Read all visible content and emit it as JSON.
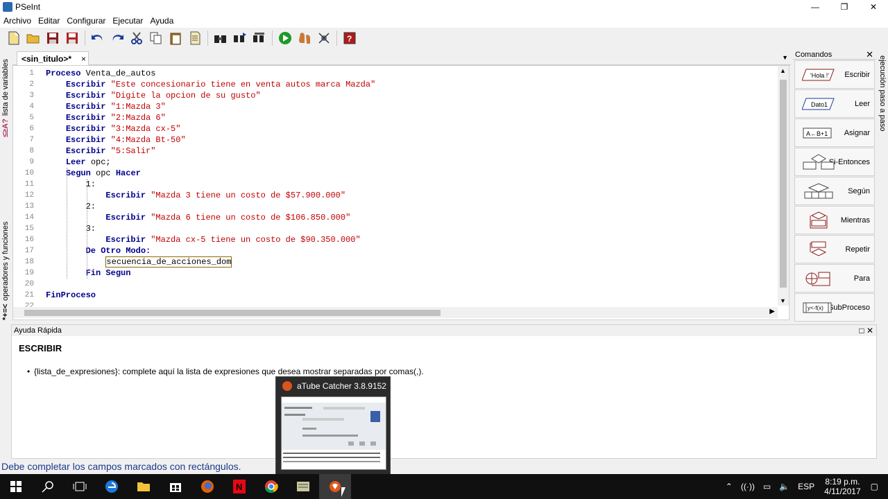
{
  "window": {
    "title": "PSeInt",
    "controls": [
      "—",
      "❐",
      "✕"
    ]
  },
  "menu": [
    "Archivo",
    "Editar",
    "Configurar",
    "Ejecutar",
    "Ayuda"
  ],
  "toolbar": {
    "icons": [
      "new-file-icon",
      "open-folder-icon",
      "save-icon",
      "save-as-icon",
      "undo-icon",
      "redo-icon",
      "cut-icon",
      "copy-icon",
      "paste-icon",
      "edit-icon",
      "search-icon",
      "find-next-icon",
      "replace-icon",
      "run-icon",
      "step-icon",
      "debug-icon",
      "help-icon"
    ]
  },
  "left_strip": {
    "variables_label": "lista de variables",
    "operators_label": "operadores y funciones",
    "var_glyphs": "≤≥A?",
    "op_glyphs": "*+=<"
  },
  "right_strip": {
    "label": "ejecución paso a paso"
  },
  "tab": {
    "label": "<sin_titulo>*",
    "close": "×"
  },
  "editor": {
    "line_numbers": [
      "1",
      "2",
      "3",
      "4",
      "5",
      "6",
      "7",
      "8",
      "9",
      "10",
      "11",
      "12",
      "13",
      "14",
      "15",
      "16",
      "17",
      "18",
      "19",
      "20",
      "21",
      "22"
    ],
    "lines": [
      [
        {
          "t": "kw",
          "v": "Proceso"
        },
        {
          "t": "n",
          "v": " Venta_de_autos"
        }
      ],
      [
        {
          "t": "n",
          "v": "    "
        },
        {
          "t": "kw",
          "v": "Escribir"
        },
        {
          "t": "n",
          "v": " "
        },
        {
          "t": "str",
          "v": "\"Este concesionario tiene en venta autos marca Mazda\""
        }
      ],
      [
        {
          "t": "n",
          "v": "    "
        },
        {
          "t": "kw",
          "v": "Escribir"
        },
        {
          "t": "n",
          "v": " "
        },
        {
          "t": "str",
          "v": "\"Digite la opcion de su gusto\""
        }
      ],
      [
        {
          "t": "n",
          "v": "    "
        },
        {
          "t": "kw",
          "v": "Escribir"
        },
        {
          "t": "n",
          "v": " "
        },
        {
          "t": "str",
          "v": "\"1:Mazda 3\""
        }
      ],
      [
        {
          "t": "n",
          "v": "    "
        },
        {
          "t": "kw",
          "v": "Escribir"
        },
        {
          "t": "n",
          "v": " "
        },
        {
          "t": "str",
          "v": "\"2:Mazda 6\""
        }
      ],
      [
        {
          "t": "n",
          "v": "    "
        },
        {
          "t": "kw",
          "v": "Escribir"
        },
        {
          "t": "n",
          "v": " "
        },
        {
          "t": "str",
          "v": "\"3:Mazda cx-5\""
        }
      ],
      [
        {
          "t": "n",
          "v": "    "
        },
        {
          "t": "kw",
          "v": "Escribir"
        },
        {
          "t": "n",
          "v": " "
        },
        {
          "t": "str",
          "v": "\"4:Mazda Bt-50\""
        }
      ],
      [
        {
          "t": "n",
          "v": "    "
        },
        {
          "t": "kw",
          "v": "Escribir"
        },
        {
          "t": "n",
          "v": " "
        },
        {
          "t": "str",
          "v": "\"5:Salir\""
        }
      ],
      [
        {
          "t": "n",
          "v": "    "
        },
        {
          "t": "kw",
          "v": "Leer"
        },
        {
          "t": "n",
          "v": " opc;"
        }
      ],
      [
        {
          "t": "n",
          "v": "    "
        },
        {
          "t": "kw",
          "v": "Segun"
        },
        {
          "t": "n",
          "v": " opc "
        },
        {
          "t": "kw",
          "v": "Hacer"
        }
      ],
      [
        {
          "t": "n",
          "v": "        1:"
        }
      ],
      [
        {
          "t": "n",
          "v": "            "
        },
        {
          "t": "kw",
          "v": "Escribir"
        },
        {
          "t": "n",
          "v": " "
        },
        {
          "t": "str",
          "v": "\"Mazda 3 tiene un costo de $57.900.000\""
        }
      ],
      [
        {
          "t": "n",
          "v": "        2:"
        }
      ],
      [
        {
          "t": "n",
          "v": "            "
        },
        {
          "t": "kw",
          "v": "Escribir"
        },
        {
          "t": "n",
          "v": " "
        },
        {
          "t": "str",
          "v": "\"Mazda 6 tiene un costo de $106.850.000\""
        }
      ],
      [
        {
          "t": "n",
          "v": "        3:"
        }
      ],
      [
        {
          "t": "n",
          "v": "            "
        },
        {
          "t": "kw",
          "v": "Escribir"
        },
        {
          "t": "n",
          "v": " "
        },
        {
          "t": "str",
          "v": "\"Mazda cx-5 tiene un costo de $90.350.000\""
        }
      ],
      [
        {
          "t": "n",
          "v": "        "
        },
        {
          "t": "kw",
          "v": "De Otro Modo:"
        }
      ],
      [
        {
          "t": "n",
          "v": "            "
        },
        {
          "t": "box",
          "v": "secuencia_de_acciones_dom"
        }
      ],
      [
        {
          "t": "n",
          "v": "        "
        },
        {
          "t": "kw",
          "v": "Fin Segun"
        }
      ],
      [
        {
          "t": "n",
          "v": ""
        }
      ],
      [
        {
          "t": "kw",
          "v": "FinProceso"
        }
      ],
      [
        {
          "t": "n",
          "v": ""
        }
      ]
    ]
  },
  "commands": {
    "title": "Comandos",
    "items": [
      {
        "label": "Escribir",
        "icon": "'Hola !'"
      },
      {
        "label": "Leer",
        "icon": "Dato1"
      },
      {
        "label": "Asignar",
        "icon": "A←B+1"
      },
      {
        "label": "Si-Entonces",
        "icon": "if-diagram-icon"
      },
      {
        "label": "Según",
        "icon": "switch-diagram-icon"
      },
      {
        "label": "Mientras",
        "icon": "while-diagram-icon"
      },
      {
        "label": "Repetir",
        "icon": "repeat-diagram-icon"
      },
      {
        "label": "Para",
        "icon": "for-diagram-icon"
      },
      {
        "label": "SubProceso",
        "icon": "y<-f(x)"
      }
    ]
  },
  "help": {
    "header": "Ayuda Rápida",
    "title": "ESCRIBIR",
    "item": "{lista_de_expresiones}: complete aquí la lista de expresiones que desea mostrar separadas por comas(,)."
  },
  "status": "Debe completar los campos marcados con rectángulos.",
  "popup": {
    "title": "aTube Catcher 3.8.9152 ..."
  },
  "taskbar": {
    "apps": [
      "start-icon",
      "search-icon",
      "task-view-icon",
      "edge-icon",
      "explorer-icon",
      "store-icon",
      "firefox-icon",
      "netflix-icon",
      "chrome-icon",
      "pseint-icon",
      "atube-icon"
    ],
    "lang": "ESP",
    "time": "8:19 p.m.",
    "date": "4/11/2017"
  },
  "colors": {
    "keyword": "#00008b",
    "string": "#c00000",
    "status": "#1a3a8c"
  }
}
